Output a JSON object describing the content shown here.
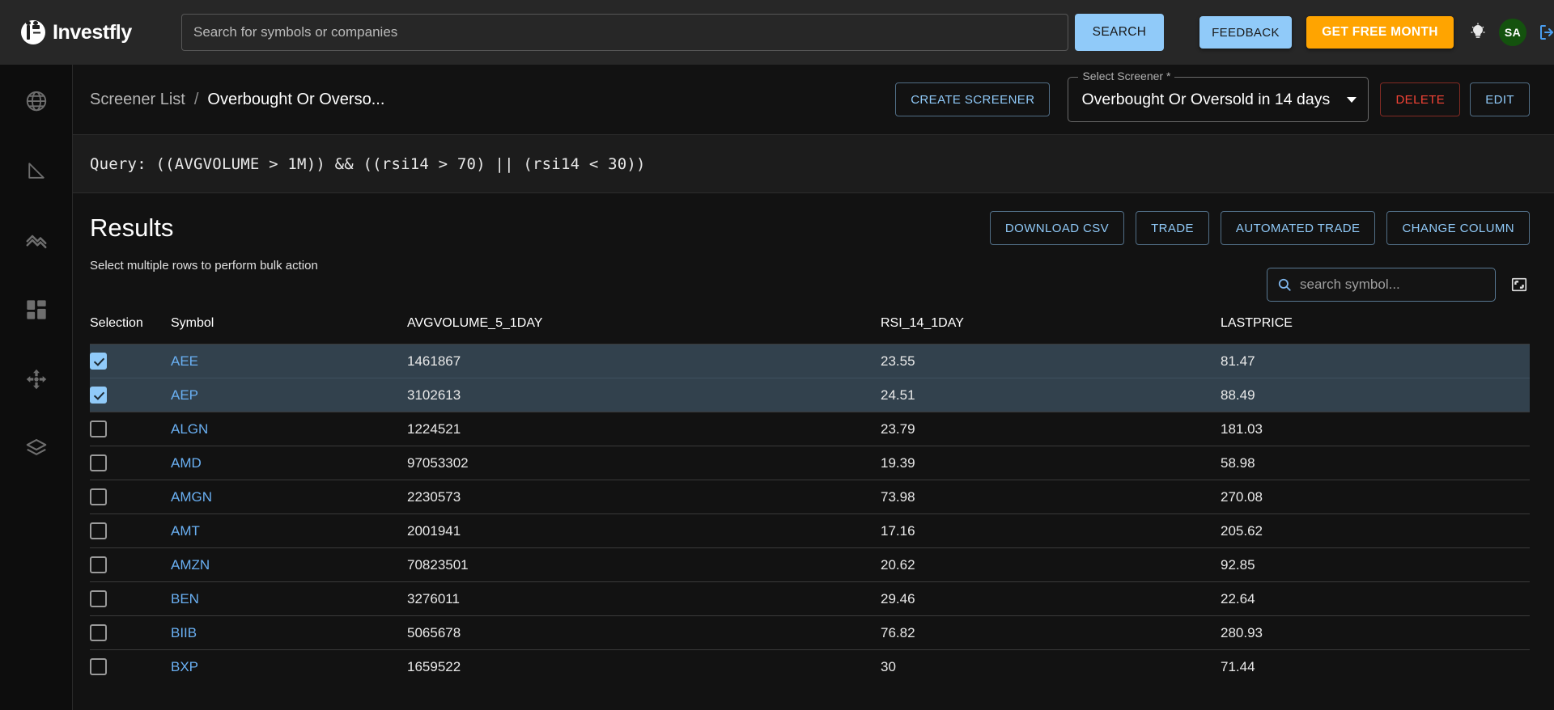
{
  "app": {
    "brand_name": "Investfly"
  },
  "header": {
    "search_placeholder": "Search for symbols or companies",
    "search_value": "",
    "search_button": "SEARCH",
    "feedback_button": "FEEDBACK",
    "get_free_month_button": "GET FREE MONTH",
    "avatar_initials": "SA",
    "bulb_icon": "lightbulb-icon",
    "logout_icon": "logout-icon"
  },
  "sidebar": {
    "items": [
      {
        "name": "globe-icon",
        "label": "Market"
      },
      {
        "name": "triangle-icon",
        "label": "Screener"
      },
      {
        "name": "chart-lines-icon",
        "label": "Charts"
      },
      {
        "name": "dashboard-grid-icon",
        "label": "Dashboard"
      },
      {
        "name": "strategy-icon",
        "label": "Strategy"
      },
      {
        "name": "layers-icon",
        "label": "Portfolio"
      }
    ]
  },
  "breadcrumb": {
    "parent": "Screener List",
    "separator": "/",
    "current": "Overbought Or Overso..."
  },
  "toolbar": {
    "create_screener": "CREATE SCREENER",
    "select_screener_label": "Select Screener *",
    "select_screener_value": "Overbought Or Oversold in 14 days",
    "delete_button": "DELETE",
    "edit_button": "EDIT"
  },
  "query": {
    "text": "Query: ((AVGVOLUME > 1M)) && ((rsi14 > 70) || (rsi14 < 30))"
  },
  "results": {
    "title": "Results",
    "hint": "Select multiple rows to perform bulk action",
    "actions": [
      "DOWNLOAD CSV",
      "TRADE",
      "AUTOMATED TRADE",
      "CHANGE COLUMN"
    ],
    "symbol_search_placeholder": "search symbol...",
    "symbol_search_value": "",
    "expand_icon": "fullscreen-icon",
    "columns": [
      "Selection",
      "Symbol",
      "AVGVOLUME_5_1DAY",
      "RSI_14_1DAY",
      "LASTPRICE"
    ],
    "rows": [
      {
        "selected": true,
        "symbol": "AEE",
        "avgvolume": "1461867",
        "rsi": "23.55",
        "lastprice": "81.47"
      },
      {
        "selected": true,
        "symbol": "AEP",
        "avgvolume": "3102613",
        "rsi": "24.51",
        "lastprice": "88.49"
      },
      {
        "selected": false,
        "symbol": "ALGN",
        "avgvolume": "1224521",
        "rsi": "23.79",
        "lastprice": "181.03"
      },
      {
        "selected": false,
        "symbol": "AMD",
        "avgvolume": "97053302",
        "rsi": "19.39",
        "lastprice": "58.98"
      },
      {
        "selected": false,
        "symbol": "AMGN",
        "avgvolume": "2230573",
        "rsi": "73.98",
        "lastprice": "270.08"
      },
      {
        "selected": false,
        "symbol": "AMT",
        "avgvolume": "2001941",
        "rsi": "17.16",
        "lastprice": "205.62"
      },
      {
        "selected": false,
        "symbol": "AMZN",
        "avgvolume": "70823501",
        "rsi": "20.62",
        "lastprice": "92.85"
      },
      {
        "selected": false,
        "symbol": "BEN",
        "avgvolume": "3276011",
        "rsi": "29.46",
        "lastprice": "22.64"
      },
      {
        "selected": false,
        "symbol": "BIIB",
        "avgvolume": "5065678",
        "rsi": "76.82",
        "lastprice": "280.93"
      },
      {
        "selected": false,
        "symbol": "BXP",
        "avgvolume": "1659522",
        "rsi": "30",
        "lastprice": "71.44"
      }
    ]
  },
  "colors": {
    "accent_blue": "#90caf9",
    "accent_orange": "#ffa400",
    "danger_red": "#f44336",
    "row_selected": "#32414d",
    "avatar_green": "#14520e"
  }
}
